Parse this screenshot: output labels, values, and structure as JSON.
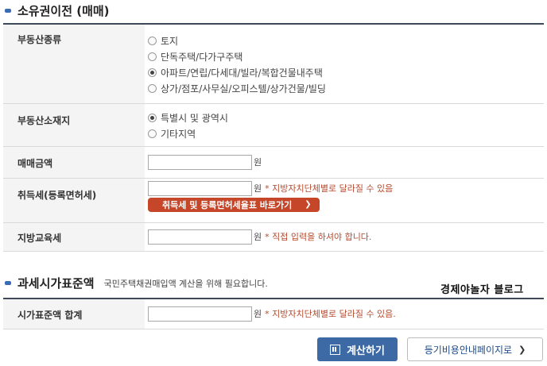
{
  "section1": {
    "title": "소유권이전 (매매)"
  },
  "form": {
    "property_type": {
      "label": "부동산종류",
      "options": [
        "토지",
        "단독주택/다가구주택",
        "아파트/연립/다세대/빌라/복합건물내주택",
        "상가/점포/사무실/오피스텔/상가건물/빌딩"
      ],
      "selected_index": 2
    },
    "location": {
      "label": "부동산소재지",
      "options": [
        "특별시 및 광역시",
        "기타지역"
      ],
      "selected_index": 0
    },
    "sale_price": {
      "label": "매매금액",
      "value": "",
      "unit": "원"
    },
    "acquisition_tax": {
      "label": "취득세(등록면허세)",
      "value": "",
      "unit": "원",
      "note": "* 지방자치단체별로 달라질 수 있음",
      "link_label": "취득세 및 등록면허세율표 바로가기"
    },
    "education_tax": {
      "label": "지방교육세",
      "value": "",
      "unit": "원",
      "note": "* 직접 입력을 하셔야 합니다."
    }
  },
  "section2": {
    "title": "과세시가표준액",
    "description": "국민주택채권매입액 계산을 위해 필요합니다.",
    "blog_label": "경제야놀자 블로그",
    "standard_total": {
      "label": "시가표준액 합계",
      "value": "",
      "unit": "원",
      "note": "* 지방자치단체별로 달라질 수 있음."
    }
  },
  "buttons": {
    "calculate": "계산하기",
    "guide": "등기비용안내페이지로"
  },
  "colors": {
    "accent_blue": "#3d6aa5",
    "note_red": "#b64a2d",
    "link_button": "#c6462a"
  }
}
